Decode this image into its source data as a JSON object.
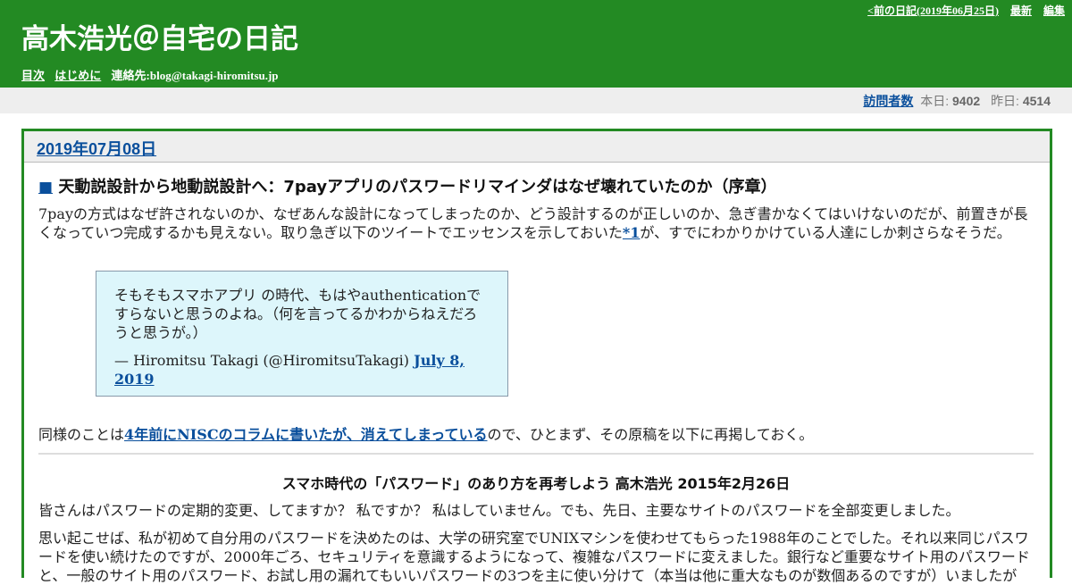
{
  "header": {
    "prev_link": "<前の日記(2019年06月25日)",
    "latest_link": "最新",
    "edit_link": "編集",
    "title": "高木浩光＠自宅の日記",
    "nav": {
      "toc": "目次",
      "intro": "はじめに",
      "contact": "連絡先:blog@takagi-hiromitsu.jp"
    }
  },
  "counter": {
    "label": "訪問者数",
    "today_label": "本日:",
    "today_value": "9402",
    "yesterday_label": "昨日:",
    "yesterday_value": "4514"
  },
  "day": {
    "date": "2019年07月08日",
    "section": {
      "mark": "■",
      "title": "天動説設計から地動説設計へ：7payアプリのパスワードリマインダはなぜ壊れていたのか（序章）",
      "para1_before": "7payの方式はなぜ許されないのか、なぜあんな設計になってしまったのか、どう設計するのが正しいのか、急ぎ書かなくてはいけないのだが、前置きが長くなっていつ完成するかも見えない。取り急ぎ以下のツイートでエッセンスを示しておいた",
      "footnote": "*1",
      "para1_after": "が、すでにわかりかけている人達にしか刺さらなそうだ。",
      "tweet_text": "そもそもスマホアプリ の時代、もはやauthenticationですらないと思うのよね。（何を言ってるかわからねえだろうと思うが。）",
      "tweet_by": "— Hiromitsu Takagi (@HiromitsuTakagi)",
      "tweet_date": "July 8, 2019",
      "para2_before": "同様のことは",
      "para2_link": "4年前にNISCのコラムに書いたが、消えてしまっている",
      "para2_after": "ので、ひとまず、その原稿を以下に再掲しておく。",
      "column_title": "スマホ時代の「パスワード」のあり方を再考しよう 高木浩光 2015年2月26日",
      "para3": "皆さんはパスワードの定期的変更、してますか？ 私ですか？ 私はしていません。でも、先日、主要なサイトのパスワードを全部変更しました。",
      "para4": "思い起こせば、私が初めて自分用のパスワードを決めたのは、大学の研究室でUNIXマシンを使わせてもらった1988年のことでした。それ以来同じパスワードを使い続けたのですが、2000年ごろ、セキュリティを意識するようになって、複雑なパスワードに変えました。銀行など重要なサイト用のパスワードと、一般のサイト用のパスワード、お試し用の漏れてもいいパスワードの3つを主に使い分けて（本当は他に重大なものが数個あるのですが）いましたが"
    }
  }
}
